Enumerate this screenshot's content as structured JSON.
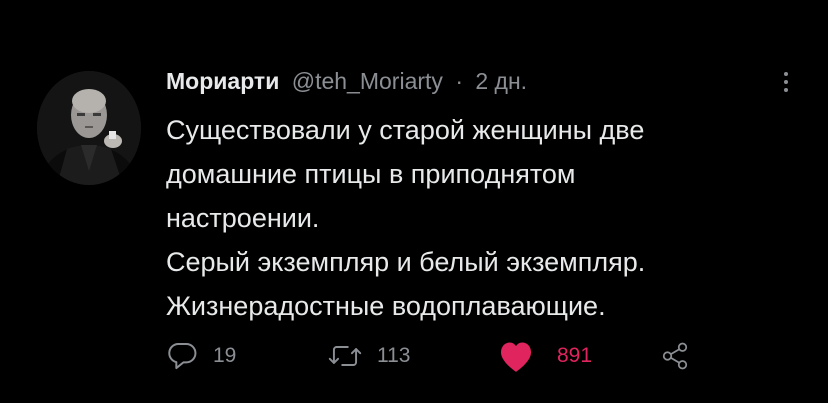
{
  "tweet": {
    "author": {
      "display_name": "Мориарти",
      "handle": "@teh_Moriarty",
      "separator": "·",
      "time": "2 дн."
    },
    "text_lines": [
      "Существовали у старой женщины две",
      "домашние птицы в приподнятом",
      "настроении.",
      "Серый экземпляр и белый экземпляр.",
      "Жизнерадостные водоплавающие."
    ],
    "stats": {
      "replies": "19",
      "retweets": "113",
      "likes": "891"
    },
    "liked": true
  },
  "colors": {
    "background": "#000000",
    "text": "#e7e9ea",
    "muted": "#8b8f94",
    "like": "#e0245e"
  },
  "icons": {
    "reply": "reply-icon",
    "retweet": "retweet-icon",
    "like": "heart-icon",
    "share": "share-icon",
    "more": "more-vertical-icon"
  }
}
